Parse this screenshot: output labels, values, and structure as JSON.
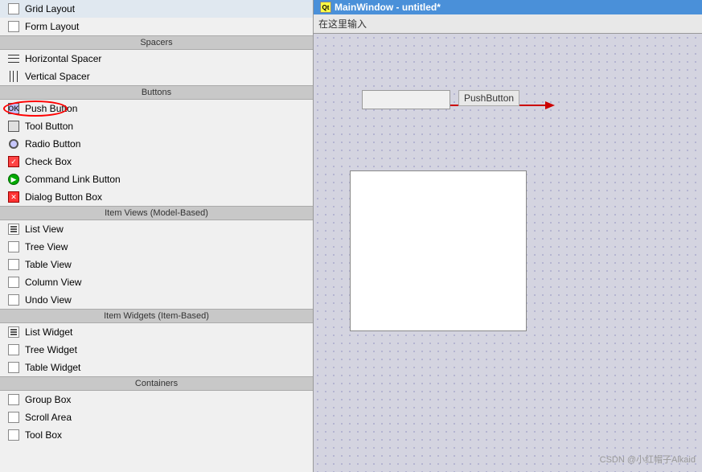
{
  "leftPanel": {
    "sections": [
      {
        "id": "layouts",
        "items": [
          {
            "id": "grid-layout",
            "label": "Grid Layout",
            "iconType": "grid"
          },
          {
            "id": "form-layout",
            "label": "Form Layout",
            "iconType": "grid"
          }
        ]
      },
      {
        "id": "spacers",
        "header": "Spacers",
        "items": [
          {
            "id": "horizontal-spacer",
            "label": "Horizontal Spacer",
            "iconType": "horiz"
          },
          {
            "id": "vertical-spacer",
            "label": "Vertical Spacer",
            "iconType": "vert"
          }
        ]
      },
      {
        "id": "buttons",
        "header": "Buttons",
        "items": [
          {
            "id": "push-button",
            "label": "Push Button",
            "iconType": "ok",
            "highlighted": true
          },
          {
            "id": "tool-button",
            "label": "Tool Button",
            "iconType": "tool"
          },
          {
            "id": "radio-button",
            "label": "Radio Button",
            "iconType": "radio"
          },
          {
            "id": "check-box",
            "label": "Check Box",
            "iconType": "check"
          },
          {
            "id": "command-link-button",
            "label": "Command Link Button",
            "iconType": "cmd"
          },
          {
            "id": "dialog-button-box",
            "label": "Dialog Button Box",
            "iconType": "dlg"
          }
        ]
      },
      {
        "id": "item-views",
        "header": "Item Views (Model-Based)",
        "items": [
          {
            "id": "list-view",
            "label": "List View",
            "iconType": "list"
          },
          {
            "id": "tree-view",
            "label": "Tree View",
            "iconType": "tree"
          },
          {
            "id": "table-view",
            "label": "Table View",
            "iconType": "table"
          },
          {
            "id": "column-view",
            "label": "Column View",
            "iconType": "col"
          },
          {
            "id": "undo-view",
            "label": "Undo View",
            "iconType": "undo"
          }
        ]
      },
      {
        "id": "item-widgets",
        "header": "Item Widgets (Item-Based)",
        "items": [
          {
            "id": "list-widget",
            "label": "List Widget",
            "iconType": "list"
          },
          {
            "id": "tree-widget",
            "label": "Tree Widget",
            "iconType": "tree"
          },
          {
            "id": "table-widget",
            "label": "Table Widget",
            "iconType": "table"
          }
        ]
      },
      {
        "id": "containers",
        "header": "Containers",
        "items": [
          {
            "id": "group-box",
            "label": "Group Box",
            "iconType": "group"
          },
          {
            "id": "scroll-area",
            "label": "Scroll Area",
            "iconType": "scroll"
          },
          {
            "id": "tool-box",
            "label": "Tool Box",
            "iconType": "toolbox"
          }
        ]
      }
    ]
  },
  "rightPanel": {
    "titleBar": "MainWindow - untitled*",
    "titleIcon": "Qt",
    "inputPlaceholder": "在这里输入",
    "formButton": {
      "label": ""
    },
    "pushButtonLabel": "PushButton",
    "watermark": "CSDN @小红帽子Alkaid"
  }
}
